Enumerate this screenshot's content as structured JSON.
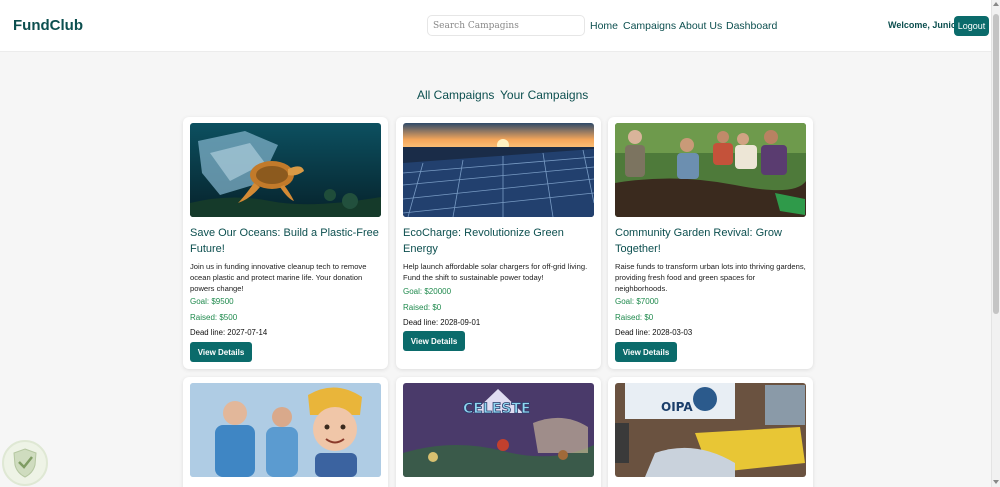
{
  "brand": "FundClub",
  "search": {
    "placeholder": "Search Campagins"
  },
  "nav": {
    "home": "Home",
    "campaigns": "Campaigns",
    "about": "About Us",
    "dashboard": "Dashboard"
  },
  "user": {
    "welcome": "Welcome, Junior",
    "logout": "Logout"
  },
  "tabs": {
    "all": "All Campaigns",
    "yours": "Your Campaigns"
  },
  "campaigns": [
    {
      "title": "Save Our Oceans: Build a Plastic-Free Future!",
      "description": "Join us in funding innovative cleanup tech to remove ocean plastic and protect marine life. Your donation powers change!",
      "goal": "Goal: $9500",
      "raised": "Raised: $500",
      "deadline": "Dead line: 2027-07-14",
      "button": "View Details"
    },
    {
      "title": "EcoCharge: Revolutionize Green Energy",
      "description": "Help launch affordable solar chargers for off-grid living. Fund the shift to sustainable power today!",
      "goal": "Goal: $20000",
      "raised": "Raised: $0",
      "deadline": "Dead line: 2028-09-01",
      "button": "View Details"
    },
    {
      "title": "Community Garden Revival: Grow Together!",
      "description": "Raise funds to transform urban lots into thriving gardens, providing fresh food and green spaces for neighborhoods.",
      "goal": "Goal: $7000",
      "raised": "Raised: $0",
      "deadline": "Dead line: 2028-03-03",
      "button": "View Details"
    }
  ],
  "celeste_logo": "CELESTE",
  "oipa_sign": "OIPA",
  "colors": {
    "primary": "#0b6b6b",
    "brand_text": "#0c4f4f",
    "money": "#1f8a4d"
  }
}
